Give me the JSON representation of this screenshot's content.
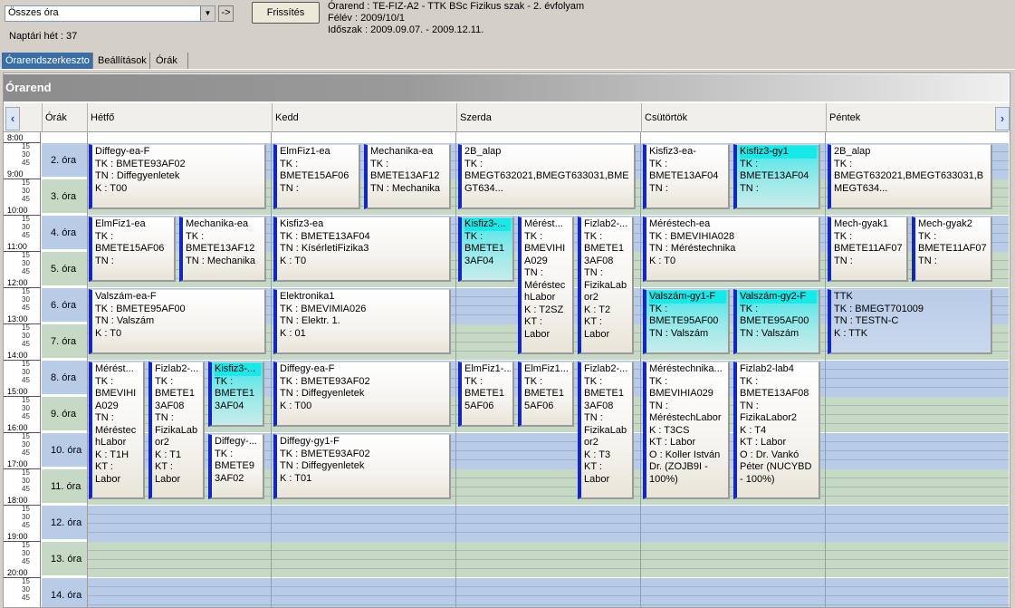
{
  "selector": {
    "value": "Összes óra",
    "go_label": "->"
  },
  "week_label": "Naptári hét : 37",
  "refresh_label": "Frissítés",
  "info": {
    "line1": "Órarend : TE-FIZ-A2 - TTK BSc Fizikus szak - 2. évfolyam",
    "line2": "Félév : 2009/10/1",
    "line3": "Időszak : 2009.09.07. - 2009.12.11."
  },
  "tabs": [
    "Órarendszerkeszto",
    "Beállítások",
    "Órák"
  ],
  "banner_title": "Órarend",
  "header": {
    "times": "Órák",
    "days": [
      "Hétfő",
      "Kedd",
      "Szerda",
      "Csütörtök",
      "Péntek"
    ]
  },
  "hours": [
    "8:00",
    "9:00",
    "10:00",
    "11:00",
    "12:00",
    "13:00",
    "14:00",
    "15:00",
    "16:00",
    "17:00",
    "18:00",
    "19:00",
    "20:00"
  ],
  "ticks": [
    "15",
    "30",
    "45"
  ],
  "periods": [
    "2. óra",
    "3. óra",
    "4. óra",
    "5. óra",
    "6. óra",
    "7. óra",
    "8. óra",
    "9. óra",
    "10. óra",
    "11. óra",
    "12. óra",
    "13. óra",
    "14. óra"
  ],
  "colors": {
    "accent": "#1226c8",
    "highlight": "#17e8e8",
    "blue_band": "#b8cce8",
    "green_band": "#c6d9c4"
  },
  "events": [
    {
      "day": 0,
      "sub": 0,
      "of": 1,
      "start": 0,
      "span": 2,
      "hl": false,
      "title": "Diffegy-ea-F",
      "body": "TK : BMETE93AF02\nTN : Diffegyenletek\nK : T00"
    },
    {
      "day": 1,
      "sub": 0,
      "of": 2,
      "start": 0,
      "span": 2,
      "hl": false,
      "title": "ElmFiz1-ea",
      "body": "TK :\nBMETE15AF06\nTN :"
    },
    {
      "day": 1,
      "sub": 1,
      "of": 2,
      "start": 0,
      "span": 2,
      "hl": false,
      "title": "Mechanika-ea",
      "body": "TK :\nBMETE13AF12\nTN : Mechanika"
    },
    {
      "day": 2,
      "sub": 0,
      "of": 1,
      "start": 0,
      "span": 2,
      "hl": false,
      "title": "2B_alap",
      "body": "TK :\nBMEGT632021,BMEGT633031,BMEGT634..."
    },
    {
      "day": 3,
      "sub": 0,
      "of": 2,
      "start": 0,
      "span": 2,
      "hl": false,
      "title": "Kisfiz3-ea-",
      "body": "TK :\nBMETE13AF04\nTN :"
    },
    {
      "day": 3,
      "sub": 1,
      "of": 2,
      "start": 0,
      "span": 2,
      "hl": true,
      "title": "Kisfiz3-gy1",
      "body": "TK :\nBMETE13AF04\nTN :"
    },
    {
      "day": 4,
      "sub": 0,
      "of": 1,
      "start": 0,
      "span": 2,
      "hl": false,
      "title": "2B_alap",
      "body": "TK :\nBMEGT632021,BMEGT633031,BMEGT634..."
    },
    {
      "day": 0,
      "sub": 0,
      "of": 2,
      "start": 2,
      "span": 2,
      "hl": false,
      "title": "ElmFiz1-ea",
      "body": "TK :\nBMETE15AF06\nTN :"
    },
    {
      "day": 0,
      "sub": 1,
      "of": 2,
      "start": 2,
      "span": 2,
      "hl": false,
      "title": "Mechanika-ea",
      "body": "TK :\nBMETE13AF12\nTN : Mechanika"
    },
    {
      "day": 1,
      "sub": 0,
      "of": 1,
      "start": 2,
      "span": 2,
      "hl": false,
      "title": "Kisfiz3-ea",
      "body": "TK : BMETE13AF04\nTN : KísérletiFizika3\nK : T0"
    },
    {
      "day": 2,
      "sub": 0,
      "of": 3,
      "start": 2,
      "span": 2,
      "hl": true,
      "title": "Kisfiz3-...",
      "body": "TK :\nBMETE1\n3AF04"
    },
    {
      "day": 2,
      "sub": 1,
      "of": 3,
      "start": 2,
      "span": 4,
      "hl": false,
      "title": "Mérést...",
      "body": "TK :\nBMEVIHI\nA029\nTN :\nMéréstec\nhLabor\nK : T2SZ\nKT :\nLabor"
    },
    {
      "day": 2,
      "sub": 2,
      "of": 3,
      "start": 2,
      "span": 4,
      "hl": false,
      "title": "Fizlab2-...",
      "body": "TK :\nBMETE1\n3AF08\nTN :\nFizikaLab\nor2\nK : T2\nKT :\nLabor"
    },
    {
      "day": 3,
      "sub": 0,
      "of": 1,
      "start": 2,
      "span": 2,
      "hl": false,
      "title": "Méréstech-ea",
      "body": "TK : BMEVIHIA028\nTN : Méréstechnika\nK : T0"
    },
    {
      "day": 4,
      "sub": 0,
      "of": 2,
      "start": 2,
      "span": 2,
      "hl": false,
      "title": "Mech-gyak1",
      "body": "TK :\nBMETE11AF07\nTN :"
    },
    {
      "day": 4,
      "sub": 1,
      "of": 2,
      "start": 2,
      "span": 2,
      "hl": false,
      "title": "Mech-gyak2",
      "body": "TK :\nBMETE11AF07\nTN :"
    },
    {
      "day": 0,
      "sub": 0,
      "of": 1,
      "start": 4,
      "span": 2,
      "hl": false,
      "title": "Valszám-ea-F",
      "body": "TK : BMETE95AF00\nTN : Valszám\nK : T0"
    },
    {
      "day": 1,
      "sub": 0,
      "of": 1,
      "start": 4,
      "span": 2,
      "hl": false,
      "title": "Elektronika1",
      "body": "TK : BMEVIMIA026\nTN : Elektr. 1.\nK : 01"
    },
    {
      "day": 3,
      "sub": 0,
      "of": 2,
      "start": 4,
      "span": 2,
      "hl": true,
      "title": "Valszám-gy1-F",
      "body": "TK :\nBMETE95AF00\nTN : Valszám"
    },
    {
      "day": 3,
      "sub": 1,
      "of": 2,
      "start": 4,
      "span": 2,
      "hl": true,
      "title": "Valszám-gy2-F",
      "body": "TK :\nBMETE95AF00\nTN : Valszám"
    },
    {
      "day": 4,
      "sub": 0,
      "of": 1,
      "start": 4,
      "span": 2,
      "hl": false,
      "blue": true,
      "title": "TTK",
      "body": "TK : BMEGT701009\nTN : TESTN-C\nK : TTK"
    },
    {
      "day": 0,
      "sub": 0,
      "of": 3,
      "start": 6,
      "span": 4,
      "hl": false,
      "title": "Mérést...",
      "body": "TK :\nBMEVIHI\nA029\nTN :\nMéréstec\nhLabor\nK : T1H\nKT :\nLabor"
    },
    {
      "day": 0,
      "sub": 1,
      "of": 3,
      "start": 6,
      "span": 4,
      "hl": false,
      "title": "Fizlab2-...",
      "body": "TK :\nBMETE1\n3AF08\nTN :\nFizikaLab\nor2\nK : T1\nKT :\nLabor"
    },
    {
      "day": 0,
      "sub": 2,
      "of": 3,
      "start": 6,
      "span": 2,
      "hl": true,
      "title": "Kisfiz3-...",
      "body": "TK :\nBMETE1\n3AF04"
    },
    {
      "day": 0,
      "sub": 2,
      "of": 3,
      "start": 8,
      "span": 2,
      "hl": false,
      "title": "Diffegy-...",
      "body": "TK :\nBMETE9\n3AF02"
    },
    {
      "day": 1,
      "sub": 0,
      "of": 1,
      "start": 6,
      "span": 2,
      "hl": false,
      "title": "Diffegy-ea-F",
      "body": "TK : BMETE93AF02\nTN : Diffegyenletek\nK : T00"
    },
    {
      "day": 1,
      "sub": 0,
      "of": 1,
      "start": 8,
      "span": 2,
      "hl": false,
      "title": "Diffegy-gy1-F",
      "body": "TK : BMETE93AF02\nTN : Diffegyenletek\nK : T01"
    },
    {
      "day": 2,
      "sub": 0,
      "of": 3,
      "start": 6,
      "span": 2,
      "hl": false,
      "title": "ElmFiz1-...",
      "body": "TK :\nBMETE1\n5AF06"
    },
    {
      "day": 2,
      "sub": 1,
      "of": 3,
      "start": 6,
      "span": 2,
      "hl": false,
      "title": "ElmFiz1...",
      "body": "TK :\nBMETE1\n5AF06"
    },
    {
      "day": 2,
      "sub": 2,
      "of": 3,
      "start": 6,
      "span": 4,
      "hl": false,
      "title": "Fizlab2-...",
      "body": "TK :\nBMETE1\n3AF08\nTN :\nFizikaLab\nor2\nK : T3\nKT :\nLabor"
    },
    {
      "day": 3,
      "sub": 0,
      "of": 2,
      "start": 6,
      "span": 4,
      "hl": false,
      "title": "Méréstechnika...",
      "body": "TK :\nBMEVIHIA029\nTN :\nMéréstechLabor\nK : T3CS\nKT : Labor\nO : Koller István\nDr. (ZOJB9I -\n100%)"
    },
    {
      "day": 3,
      "sub": 1,
      "of": 2,
      "start": 6,
      "span": 4,
      "hl": false,
      "title": "Fizlab2-lab4",
      "body": "TK :\nBMETE13AF08\nTN :\nFizikaLabor2\nK : T4\nKT : Labor\nO : Dr. Vankó\nPéter (NUCYBD\n- 100%)"
    }
  ]
}
